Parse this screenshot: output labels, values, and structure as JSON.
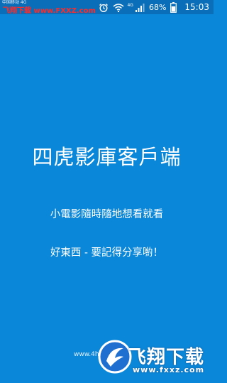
{
  "status_bar": {
    "carrier": "中国移动 4G",
    "network_label": "4G",
    "battery_percent": "68%",
    "time": "15:03",
    "icons": [
      "alarm-icon",
      "wifi-icon",
      "signal-icon",
      "battery-icon"
    ]
  },
  "watermark_top": {
    "brand": "飞翔下载",
    "site": "www.FXXZ.com"
  },
  "splash": {
    "title": "四虎影庫客戶端",
    "tagline1": "小電影隨時隨地想看就看",
    "tagline2": "好東西 - 要記得分享喲！",
    "url": "www.4h"
  },
  "watermark_bottom": {
    "brand": "飞翔下载",
    "url": "www.fxxz.com"
  },
  "colors": {
    "background": "#0a87d8",
    "status_bar": "#0a6fb8",
    "text": "#ffffff",
    "watermark_red": "#ff2a2a"
  }
}
